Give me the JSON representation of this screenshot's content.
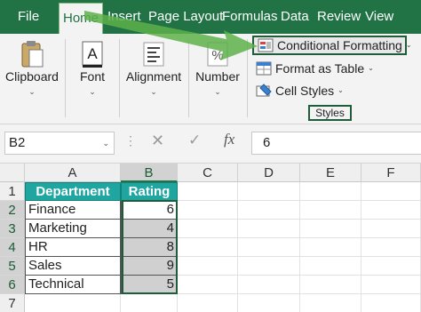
{
  "ribbon_tabs": [
    "File",
    "Home",
    "Insert",
    "Page Layout",
    "Formulas",
    "Data",
    "Review",
    "View"
  ],
  "active_tab": "Home",
  "groups": {
    "clipboard": "Clipboard",
    "font": "Font",
    "alignment": "Alignment",
    "number": "Number"
  },
  "styles_group": {
    "conditional_formatting": "Conditional Formatting",
    "format_as_table": "Format as Table",
    "cell_styles": "Cell Styles",
    "label": "Styles"
  },
  "formula_bar": {
    "name_box": "B2",
    "fx": "fx",
    "value": "6"
  },
  "columns": [
    "A",
    "B",
    "C",
    "D",
    "E",
    "F"
  ],
  "rows": [
    "1",
    "2",
    "3",
    "4",
    "5",
    "6",
    "7"
  ],
  "table": {
    "headers": [
      "Department",
      "Rating"
    ],
    "rows": [
      {
        "department": "Finance",
        "rating": "6"
      },
      {
        "department": "Marketing",
        "rating": "4"
      },
      {
        "department": "HR",
        "rating": "8"
      },
      {
        "department": "Sales",
        "rating": "9"
      },
      {
        "department": "Technical",
        "rating": "5"
      }
    ]
  },
  "colors": {
    "ribbon_green": "#217346",
    "header_teal": "#1fa6a0",
    "selection_gray": "#d0d0d0"
  }
}
